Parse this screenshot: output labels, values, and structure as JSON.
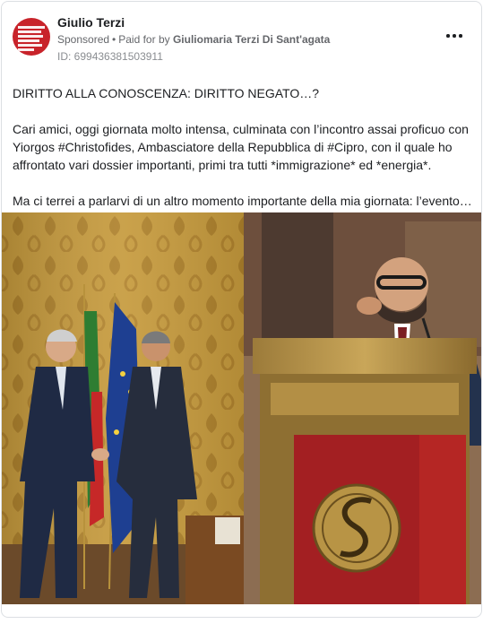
{
  "post": {
    "author": "Giulio Terzi",
    "sponsored": "Sponsored",
    "paid_prefix": "Paid for by",
    "paid_by": "Giuliomaria Terzi Di Sant'agata",
    "id_line": "ID: 699436381503911",
    "lines": [
      "DIRITTO ALLA CONOSCENZA: DIRITTO NEGATO…?",
      "Cari amici, oggi giornata molto intensa, culminata con l’incontro assai proficuo con",
      "Yiorgos #Christofides, Ambasciatore della Repubblica di #Cipro, con il quale ho",
      "affrontato vari dossier importanti, primi tra tutti *immigrazione* ed *energia*.",
      "Ma ci terrei a parlarvi di un altro momento importante della mia giornata: l’evento…"
    ]
  },
  "colors": {
    "avatar_red": "#c8232a",
    "text": "#1c1e21",
    "secondary": "#65676b"
  },
  "icons": {
    "more": "more-options-icon"
  }
}
